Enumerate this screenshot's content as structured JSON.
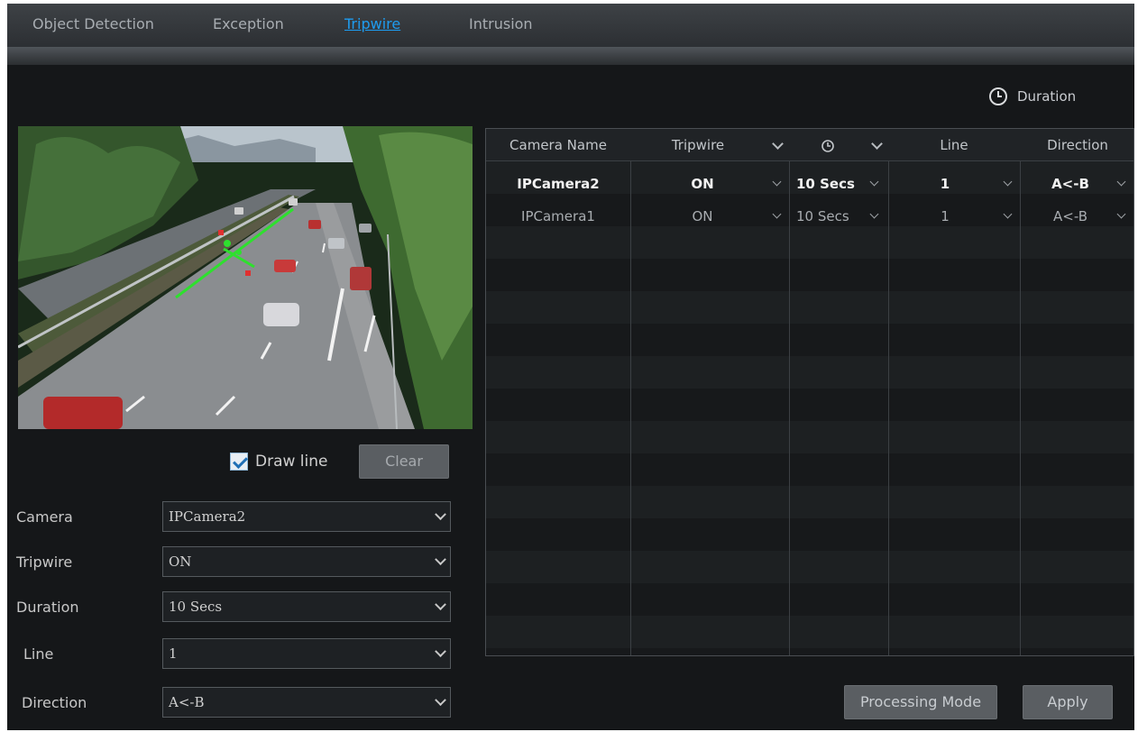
{
  "tabs": [
    {
      "label": "Object Detection",
      "active": false
    },
    {
      "label": "Exception",
      "active": false
    },
    {
      "label": "Tripwire",
      "active": true
    },
    {
      "label": "Intrusion",
      "active": false
    }
  ],
  "legend": {
    "label": "Duration",
    "icon": "clock-icon"
  },
  "preview": {
    "draw_line_label": "Draw line",
    "draw_line_checked": true,
    "clear_label": "Clear"
  },
  "form": {
    "camera": {
      "label": "Camera",
      "value": "IPCamera2"
    },
    "tripwire": {
      "label": "Tripwire",
      "value": "ON"
    },
    "duration": {
      "label": "Duration",
      "value": "10 Secs"
    },
    "line": {
      "label": "Line",
      "value": "1"
    },
    "direction": {
      "label": "Direction",
      "value": "A<-B"
    }
  },
  "table": {
    "columns": {
      "camera_name": "Camera Name",
      "tripwire": "Tripwire",
      "duration_icon": "clock-icon",
      "line": "Line",
      "direction": "Direction"
    },
    "rows": [
      {
        "camera_name": "IPCamera2",
        "tripwire": "ON",
        "duration": "10 Secs",
        "line": "1",
        "direction": "A<-B",
        "selected": true
      },
      {
        "camera_name": "IPCamera1",
        "tripwire": "ON",
        "duration": "10 Secs",
        "line": "1",
        "direction": "A<-B",
        "selected": false
      }
    ]
  },
  "buttons": {
    "processing_mode": "Processing Mode",
    "apply": "Apply"
  },
  "colors": {
    "active_tab": "#1e9cf0",
    "tripwire_line": "#2ee02e",
    "background": "#151719"
  }
}
